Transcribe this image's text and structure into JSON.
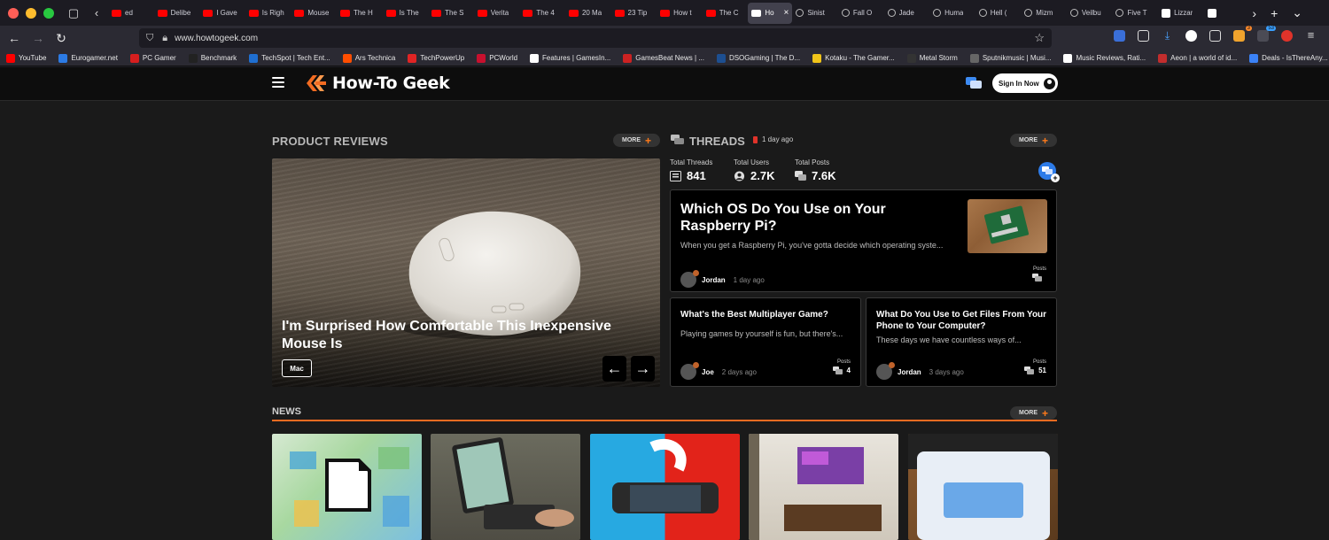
{
  "browser": {
    "tabs": [
      {
        "title": "ed",
        "favicon": "youtube"
      },
      {
        "title": "Delibe",
        "favicon": "youtube"
      },
      {
        "title": "I Gave",
        "favicon": "youtube"
      },
      {
        "title": "Is Righ",
        "favicon": "youtube"
      },
      {
        "title": "Mouse",
        "favicon": "youtube"
      },
      {
        "title": "The H",
        "favicon": "youtube"
      },
      {
        "title": "Is The",
        "favicon": "youtube"
      },
      {
        "title": "The S",
        "favicon": "youtube"
      },
      {
        "title": "Verita",
        "favicon": "youtube"
      },
      {
        "title": "The 4",
        "favicon": "youtube"
      },
      {
        "title": "20 Ma",
        "favicon": "youtube"
      },
      {
        "title": "23 Tip",
        "favicon": "youtube"
      },
      {
        "title": "How t",
        "favicon": "youtube"
      },
      {
        "title": "The C",
        "favicon": "youtube"
      },
      {
        "title": "Ho",
        "favicon": "howtogeek",
        "active": true
      },
      {
        "title": "Sinist",
        "favicon": "metacritic"
      },
      {
        "title": "Fall O",
        "favicon": "metacritic"
      },
      {
        "title": "Jade",
        "favicon": "metacritic"
      },
      {
        "title": "Huma",
        "favicon": "metacritic"
      },
      {
        "title": "Hell (",
        "favicon": "metacritic"
      },
      {
        "title": "Mizm",
        "favicon": "metacritic"
      },
      {
        "title": "Veilbu",
        "favicon": "metacritic"
      },
      {
        "title": "Five T",
        "favicon": "metacritic"
      },
      {
        "title": "Lizzar",
        "favicon": "site"
      },
      {
        "title": "",
        "favicon": "site"
      }
    ],
    "url": "www.howtogeek.com",
    "bookmarks": [
      {
        "label": "YouTube",
        "color": "#ff0000"
      },
      {
        "label": "Eurogamer.net",
        "color": "#2c7be5"
      },
      {
        "label": "PC Gamer",
        "color": "#d61e1e"
      },
      {
        "label": "Benchmark",
        "color": "#222222"
      },
      {
        "label": "TechSpot | Tech Ent...",
        "color": "#1f6fd1"
      },
      {
        "label": "Ars Technica",
        "color": "#ff4e00"
      },
      {
        "label": "TechPowerUp",
        "color": "#e02424"
      },
      {
        "label": "PCWorld",
        "color": "#c8102e"
      },
      {
        "label": "Features | GamesIn...",
        "color": "#ffffff"
      },
      {
        "label": "GamesBeat News | ...",
        "color": "#cc2222"
      },
      {
        "label": "DSOGaming | The D...",
        "color": "#1d4f91"
      },
      {
        "label": "Kotaku - The Gamer...",
        "color": "#f0c419"
      },
      {
        "label": "Metal Storm",
        "color": "#333333"
      },
      {
        "label": "Sputnikmusic | Musi...",
        "color": "#666666"
      },
      {
        "label": "Music Reviews, Rati...",
        "color": "#ffffff"
      },
      {
        "label": "Aeon | a world of id...",
        "color": "#c22d2d"
      },
      {
        "label": "Deals - IsThereAny...",
        "color": "#3b82f6"
      }
    ],
    "extension_badges": {
      "rss": "3",
      "mail": "53"
    }
  },
  "site": {
    "logo_text": "How-To Geek",
    "signin_label": "Sign In Now",
    "accent": "#f26b21",
    "product_reviews": {
      "title": "PRODUCT REVIEWS",
      "more_label": "MORE",
      "hero": {
        "title": "I'm Surprised How Comfortable This Inexpensive Mouse Is",
        "tag": "Mac"
      }
    },
    "threads": {
      "title": "THREADS",
      "updated": "1 day ago",
      "more_label": "MORE",
      "stats": [
        {
          "label": "Total Threads",
          "value": "841",
          "icon": "threads-icon"
        },
        {
          "label": "Total Users",
          "value": "2.7K",
          "icon": "users-icon"
        },
        {
          "label": "Total Posts",
          "value": "7.6K",
          "icon": "posts-icon"
        }
      ],
      "featured": {
        "title": "Which OS Do You Use on Your Raspberry Pi?",
        "excerpt": "When you get a Raspberry Pi, you've gotta decide which operating syste...",
        "author": "Jordan",
        "time": "1 day ago",
        "posts_label": "Posts",
        "posts": ""
      },
      "items": [
        {
          "title": "What's the Best Multiplayer Game?",
          "excerpt": "Playing games by yourself is fun, but there's...",
          "author": "Joe",
          "time": "2 days ago",
          "posts_label": "Posts",
          "posts": "4"
        },
        {
          "title": "What Do You Use to Get Files From Your Phone to Your Computer?",
          "excerpt": "These days we have countless ways of...",
          "author": "Jordan",
          "time": "3 days ago",
          "posts_label": "Posts",
          "posts": "51"
        }
      ]
    },
    "news": {
      "title": "NEWS",
      "more_label": "MORE"
    }
  }
}
